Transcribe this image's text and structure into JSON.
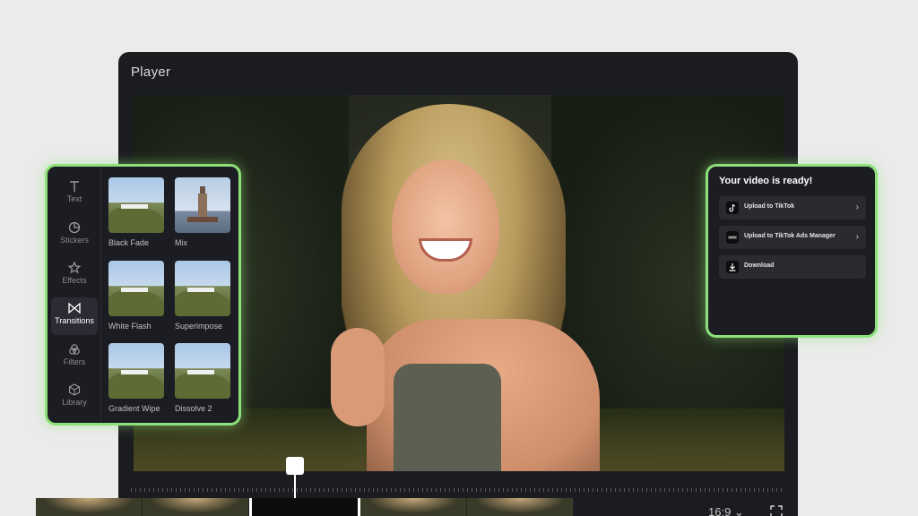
{
  "player": {
    "title": "Player",
    "aspect_ratio": "16:9 ⌄"
  },
  "left_panel": {
    "nav": [
      {
        "label": "Text",
        "icon": "text-icon"
      },
      {
        "label": "Stickers",
        "icon": "sticker-icon"
      },
      {
        "label": "Effects",
        "icon": "effects-star-icon"
      },
      {
        "label": "Transitions",
        "icon": "transitions-bowtie-icon",
        "active": true
      },
      {
        "label": "Filters",
        "icon": "filters-circles-icon"
      },
      {
        "label": "Library",
        "icon": "library-cube-icon"
      }
    ],
    "transitions": [
      {
        "label": "Black Fade"
      },
      {
        "label": "Mix"
      },
      {
        "label": "White Flash"
      },
      {
        "label": "Superimpose"
      },
      {
        "label": "Gradient Wipe"
      },
      {
        "label": "Dissolve 2"
      }
    ]
  },
  "export_panel": {
    "title": "Your video is ready!",
    "buttons": [
      {
        "label": "Upload to TikTok",
        "icon": "tiktok-icon"
      },
      {
        "label": "Upload to TikTok Ads Manager",
        "icon": "tiktok-ads-icon"
      },
      {
        "label": "Download",
        "icon": "download-icon"
      }
    ]
  },
  "colors": {
    "panel_glow": "#8de07a",
    "cursor": "#c86ee0",
    "background": "#ebebeb",
    "player_bg": "#1b1c20"
  }
}
